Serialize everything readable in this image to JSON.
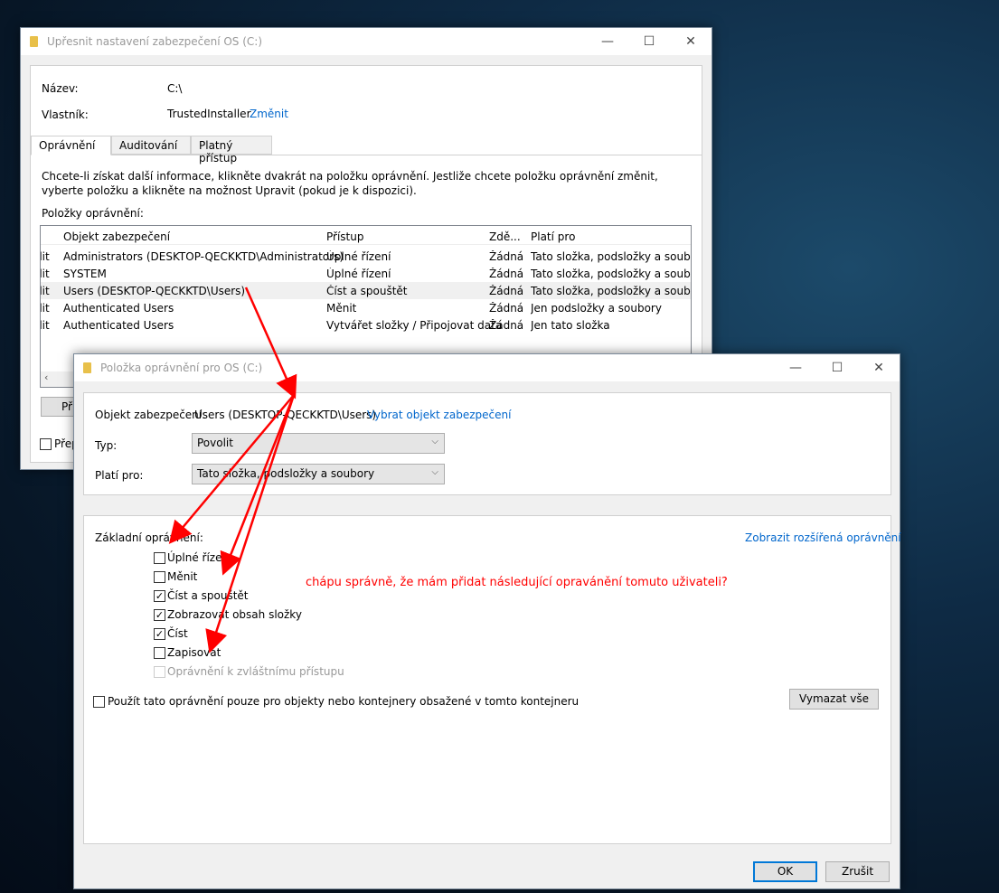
{
  "colors": {
    "accent": "#0078d7",
    "link": "#0066cc",
    "annotation": "#ff0000"
  },
  "window1": {
    "title": "Upřesnit nastavení zabezpečení OS (C:)",
    "name_label": "Název:",
    "name_value": "C:\\",
    "owner_label": "Vlastník:",
    "owner_value": "TrustedInstaller",
    "change_link": "Změnit",
    "tabs": [
      {
        "label": "Oprávnění",
        "active": true
      },
      {
        "label": "Auditování"
      },
      {
        "label": "Platný přístup"
      }
    ],
    "info": "Chcete-li získat další informace, klikněte dvakrát na položku oprávnění. Jestliže chcete položku oprávnění změnit, vyberte položku a klikněte na možnost Upravit (pokud je k dispozici).",
    "list_label": "Položky oprávnění:",
    "columns": [
      "Objekt zabezpečení",
      "Přístup",
      "Zdě...",
      "Platí pro"
    ],
    "rows": [
      {
        "type": "olit",
        "principal": "Administrators (DESKTOP-QECKKTD\\Administrators)",
        "access": "Úplné řízení",
        "inherited": "Žádná",
        "applies": "Tato složka, podsložky a soubo..."
      },
      {
        "type": "olit",
        "principal": "SYSTEM",
        "access": "Úplné řízení",
        "inherited": "Žádná",
        "applies": "Tato složka, podsložky a soubo..."
      },
      {
        "type": "olit",
        "principal": "Users (DESKTOP-QECKKTD\\Users)",
        "access": "Číst a spouštět",
        "inherited": "Žádná",
        "applies": "Tato složka, podsložky a soubo...",
        "selected": true
      },
      {
        "type": "olit",
        "principal": "Authenticated Users",
        "access": "Měnit",
        "inherited": "Žádná",
        "applies": "Jen podsložky a soubory"
      },
      {
        "type": "olit",
        "principal": "Authenticated Users",
        "access": "Vytvářet složky / Připojovat data",
        "inherited": "Žádná",
        "applies": "Jen tato složka"
      }
    ],
    "add_button": "Při",
    "replace_checkbox": "Přep"
  },
  "window2": {
    "title": "Položka oprávnění pro OS (C:)",
    "principal_label": "Objekt zabezpečení:",
    "principal_value": "Users (DESKTOP-QECKKTD\\Users)",
    "select_principal_link": "Vybrat objekt zabezpečení",
    "type_label": "Typ:",
    "type_value": "Povolit",
    "applies_label": "Platí pro:",
    "applies_value": "Tato složka, podsložky a soubory",
    "basic_label": "Základní oprávnění:",
    "advanced_link": "Zobrazit rozšířená oprávnění",
    "permissions": [
      {
        "label": "Úplné řízení",
        "checked": false
      },
      {
        "label": "Měnit",
        "checked": false
      },
      {
        "label": "Číst a spouštět",
        "checked": true
      },
      {
        "label": "Zobrazovat obsah složky",
        "checked": true
      },
      {
        "label": "Číst",
        "checked": true
      },
      {
        "label": "Zapisovat",
        "checked": false
      },
      {
        "label": "Oprávnění k zvláštnímu přístupu",
        "checked": false,
        "disabled": true
      }
    ],
    "apply_only_label": "Použít tato oprávnění pouze pro objekty nebo kontejnery obsažené v tomto kontejneru",
    "clear_all": "Vymazat vše",
    "ok": "OK",
    "cancel": "Zrušit"
  },
  "annotation": "chápu správně, že mám přidat následující opravánění tomuto uživateli?"
}
